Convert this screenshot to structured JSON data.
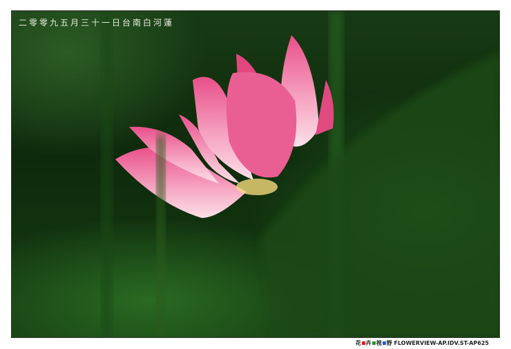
{
  "photo": {
    "caption": "二零零九五月三十一日台南白河蓮",
    "subject": "pink lotus flower"
  },
  "credit": {
    "chars": [
      "花",
      "卉",
      "視",
      "野"
    ],
    "site": "FLOWERVIEW-AP.IDV.ST-AP625",
    "square_colors": [
      "#e02020",
      "#20a020",
      "#2060e0"
    ]
  }
}
